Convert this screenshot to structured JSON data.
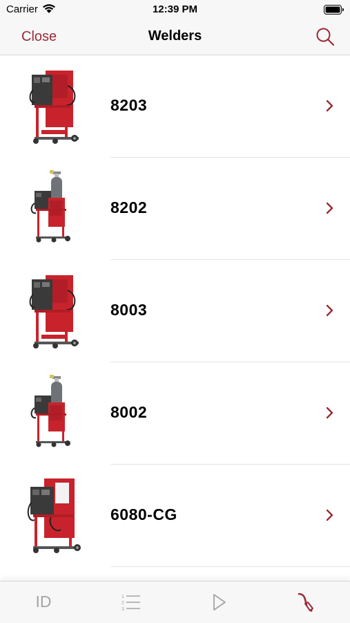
{
  "status_bar": {
    "carrier": "Carrier",
    "time": "12:39 PM"
  },
  "nav": {
    "close_label": "Close",
    "title": "Welders",
    "search_icon": "search-icon"
  },
  "list": {
    "items": [
      {
        "label": "8203",
        "image": "welder-cart-image"
      },
      {
        "label": "8202",
        "image": "welder-with-gas-bottle-image"
      },
      {
        "label": "8003",
        "image": "welder-cart-image"
      },
      {
        "label": "8002",
        "image": "welder-with-gas-bottle-image"
      },
      {
        "label": "6080-CG",
        "image": "welder-cart-image"
      }
    ]
  },
  "tab_bar": {
    "tabs": [
      {
        "label": "ID",
        "icon": "id-text-icon",
        "selected": false
      },
      {
        "icon": "numbered-list-icon",
        "selected": false
      },
      {
        "icon": "play-icon",
        "selected": false
      },
      {
        "icon": "welding-torch-icon",
        "selected": true
      }
    ]
  },
  "colors": {
    "accent": "#9b2a35",
    "inactive_tab": "#a4a4a4",
    "background": "#ffffff",
    "bar": "#f7f7f7"
  }
}
